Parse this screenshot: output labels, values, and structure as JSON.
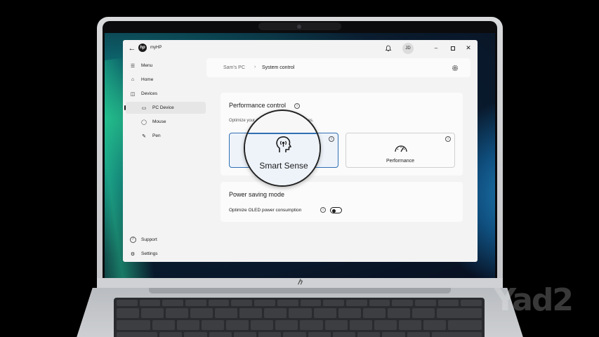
{
  "app": {
    "title": "myHP",
    "logo_text": "hp",
    "avatar_initials": "JD"
  },
  "sidebar": {
    "items": [
      {
        "label": "Menu",
        "icon": "hamburger-icon"
      },
      {
        "label": "Home",
        "icon": "home-icon"
      },
      {
        "label": "Devices",
        "icon": "devices-icon"
      },
      {
        "label": "PC Device",
        "icon": "monitor-icon"
      },
      {
        "label": "Mouse",
        "icon": "mouse-icon"
      },
      {
        "label": "Pen",
        "icon": "pen-icon"
      }
    ],
    "footer": [
      {
        "label": "Support",
        "icon": "help-icon"
      },
      {
        "label": "Settings",
        "icon": "gear-icon"
      }
    ]
  },
  "breadcrumb": {
    "parent": "Sam's PC",
    "current": "System control"
  },
  "performance_control": {
    "title": "Performance control",
    "description": "Optimize your                              noise and cooling preferences.",
    "options": [
      {
        "label": "Smart Sense",
        "selected": true
      },
      {
        "label": "Performance",
        "selected": false
      }
    ]
  },
  "power_saving": {
    "title": "Power saving mode",
    "oled_label": "Optimize OLED power consumption",
    "oled_enabled": false
  },
  "watermark": "Yad2",
  "colors": {
    "accent": "#2f6fb3",
    "app_bg": "#f3f3f3",
    "card_bg": "#fbfbfb"
  }
}
